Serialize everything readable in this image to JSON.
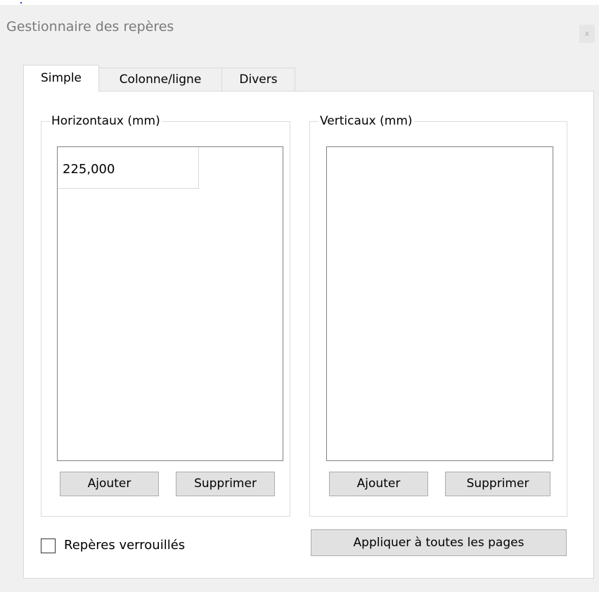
{
  "window": {
    "title": "Gestionnaire des repères",
    "close_label": "x"
  },
  "tabs": [
    {
      "label": "Simple",
      "active": true
    },
    {
      "label": "Colonne/ligne",
      "active": false
    },
    {
      "label": "Divers",
      "active": false
    }
  ],
  "horizontal": {
    "label": "Horizontaux (mm)",
    "items": [
      "225,000"
    ],
    "add_label": "Ajouter",
    "remove_label": "Supprimer"
  },
  "vertical": {
    "label": "Verticaux (mm)",
    "items": [],
    "add_label": "Ajouter",
    "remove_label": "Supprimer"
  },
  "lock_guides": {
    "label": "Repères verrouillés",
    "checked": false
  },
  "apply_all_label": "Appliquer à toutes les pages"
}
